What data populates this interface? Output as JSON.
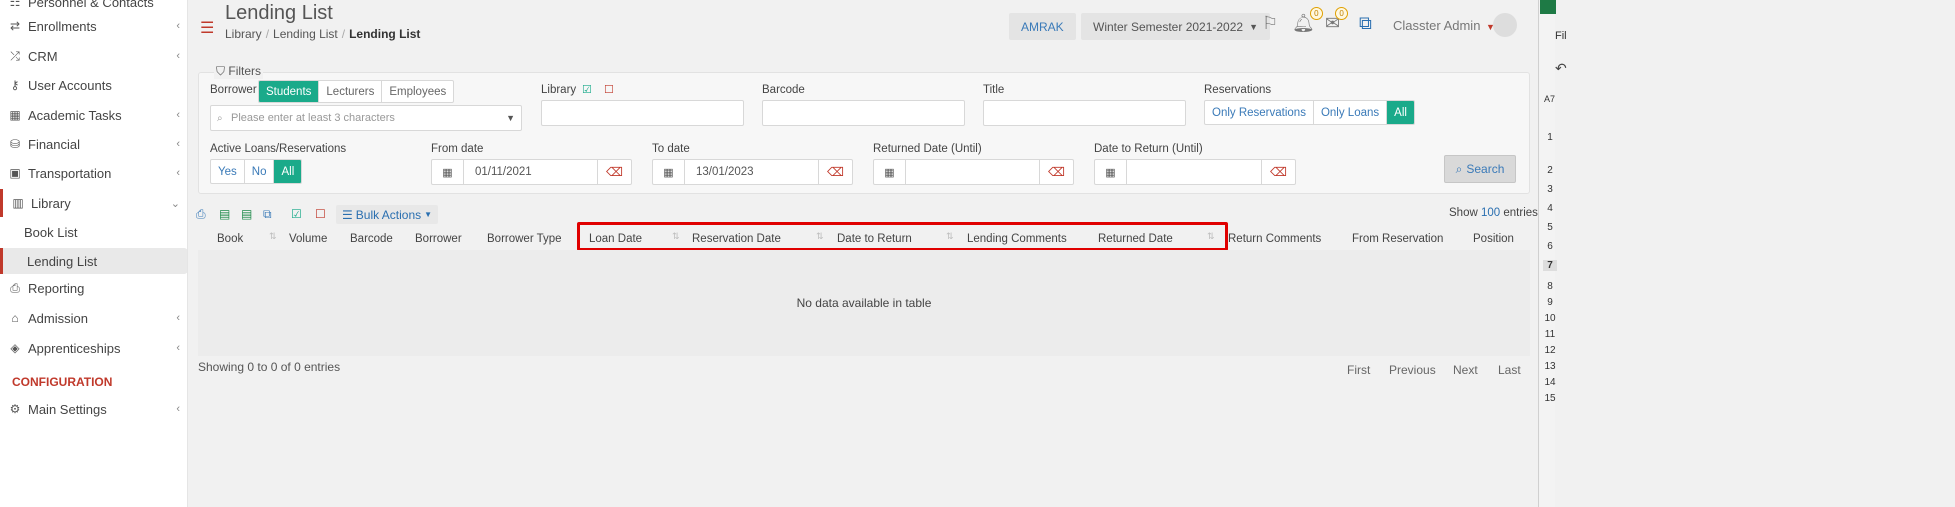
{
  "sidebar": {
    "items": [
      {
        "label": "Personnel & Contacts",
        "icon": "contacts-icon",
        "chevron": true
      },
      {
        "label": "Enrollments",
        "icon": "exchange-icon",
        "chevron": true
      },
      {
        "label": "CRM",
        "icon": "shuffle-icon",
        "chevron": true
      },
      {
        "label": "User Accounts",
        "icon": "key-icon",
        "chevron": false
      },
      {
        "label": "Academic Tasks",
        "icon": "grid-icon",
        "chevron": true
      },
      {
        "label": "Financial",
        "icon": "coins-icon",
        "chevron": true
      },
      {
        "label": "Transportation",
        "icon": "bus-icon",
        "chevron": true
      },
      {
        "label": "Library",
        "icon": "books-icon",
        "chevron": true
      },
      {
        "label": "Reporting",
        "icon": "printer-icon",
        "chevron": false
      },
      {
        "label": "Admission",
        "icon": "institution-icon",
        "chevron": true
      },
      {
        "label": "Apprenticeships",
        "icon": "cube-icon",
        "chevron": true
      },
      {
        "label": "Main Settings",
        "icon": "settings-icon",
        "chevron": true
      }
    ],
    "sub_items": [
      "Book List",
      "Lending List"
    ],
    "section": "CONFIGURATION"
  },
  "header": {
    "title": "Lending List",
    "breadcrumb": [
      "Library",
      "Lending List",
      "Lending List"
    ],
    "org": "AMRAK",
    "semester": "Winter Semester 2021-2022",
    "notif_count": "0",
    "mail_count": "0",
    "user": "Classter Admin"
  },
  "filters": {
    "title": "Filters",
    "borrower_label": "Borrower",
    "borrower_options": [
      "Students",
      "Lecturers",
      "Employees"
    ],
    "borrower_selected": "Students",
    "borrower_placeholder": "Please enter at least 3 characters",
    "library_label": "Library",
    "barcode_label": "Barcode",
    "title_label": "Title",
    "reservations_label": "Reservations",
    "reservations_options": [
      "Only Reservations",
      "Only Loans",
      "All"
    ],
    "reservations_selected": "All",
    "active_label": "Active Loans/Reservations",
    "active_options": [
      "Yes",
      "No",
      "All"
    ],
    "active_selected": "All",
    "from_date_label": "From date",
    "from_date_value": "01/11/2021",
    "to_date_label": "To date",
    "to_date_value": "13/01/2023",
    "returned_label": "Returned Date (Until)",
    "date_to_return_label": "Date to Return (Until)",
    "search_label": "Search"
  },
  "toolbar": {
    "bulk_label": "Bulk Actions",
    "show_label": "Show",
    "show_count": "100",
    "entries_label": "entries"
  },
  "table": {
    "columns": [
      "Book",
      "Volume",
      "Barcode",
      "Borrower",
      "Borrower Type",
      "Loan Date",
      "Reservation Date",
      "Date to Return",
      "Lending Comments",
      "Returned Date",
      "Return Comments",
      "From Reservation",
      "Position"
    ],
    "empty_text": "No data available in table",
    "info": "Showing 0 to 0 of 0 entries",
    "pager": [
      "First",
      "Previous",
      "Next",
      "Last"
    ]
  },
  "spreadsheet_strip": {
    "cell_ref": "A7",
    "menu": "Fil",
    "rows": [
      "1",
      "2",
      "3",
      "4",
      "5",
      "6",
      "7",
      "8",
      "9",
      "10",
      "11",
      "12",
      "13",
      "14",
      "15"
    ]
  },
  "colors": {
    "accent": "#1aaa8a",
    "brand_red": "#c0392b",
    "link": "#2a6fb0",
    "highlight": "#e00000"
  }
}
